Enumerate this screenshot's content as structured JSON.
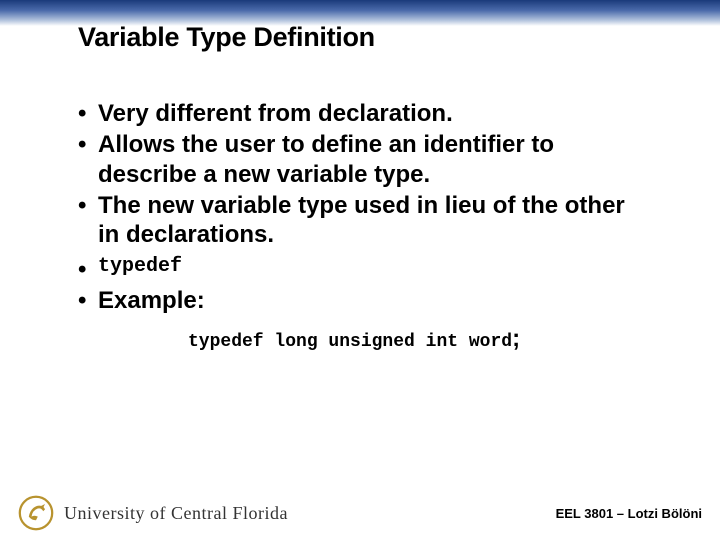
{
  "title": "Variable Type Definition",
  "bullets": {
    "b0": "Very different from declaration.",
    "b1": "Allows the user to define an identifier to describe a new variable type.",
    "b2": "The new variable type used in lieu of the other in declarations.",
    "b3": "typedef",
    "b4": "Example:"
  },
  "example_code": "typedef long unsigned int word",
  "example_semi": ";",
  "footer": {
    "university": "University of Central Florida",
    "course": "EEL 3801 – Lotzi Bölöni"
  }
}
